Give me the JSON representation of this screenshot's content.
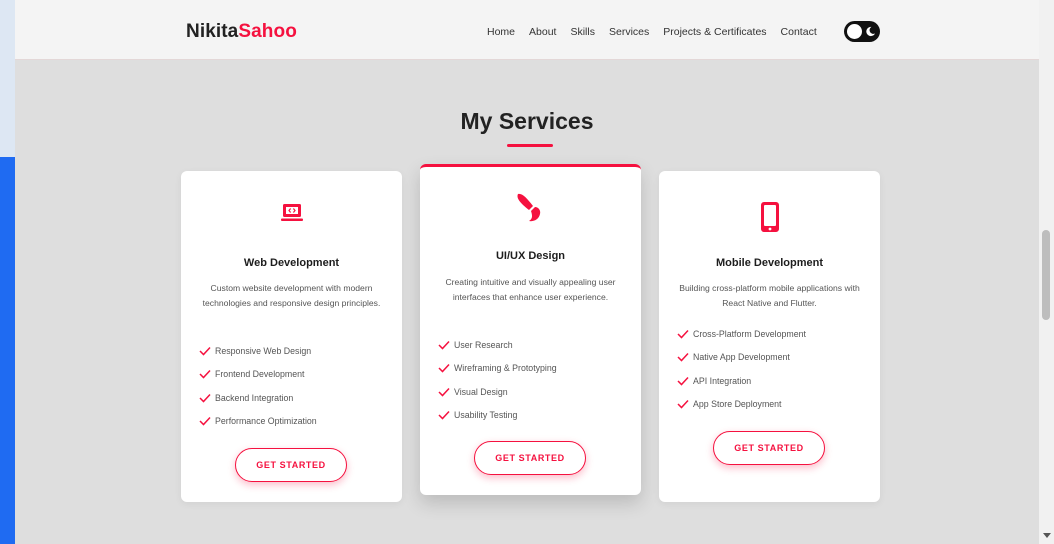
{
  "brand": {
    "first": "Nikita",
    "second": "Sahoo"
  },
  "nav": {
    "items": [
      "Home",
      "About",
      "Skills",
      "Services",
      "Projects & Certificates",
      "Contact"
    ]
  },
  "section": {
    "title": "My Services"
  },
  "cards": [
    {
      "icon": "laptop-code-icon",
      "title": "Web Development",
      "description": "Custom website development with modern technologies and responsive design principles.",
      "features": [
        "Responsive Web Design",
        "Frontend Development",
        "Backend Integration",
        "Performance Optimization"
      ],
      "button": "GET STARTED"
    },
    {
      "icon": "paint-brush-icon",
      "title": "UI/UX Design",
      "description": "Creating intuitive and visually appealing user interfaces that enhance user experience.",
      "features": [
        "User Research",
        "Wireframing & Prototyping",
        "Visual Design",
        "Usability Testing"
      ],
      "button": "GET STARTED"
    },
    {
      "icon": "mobile-icon",
      "title": "Mobile Development",
      "description": "Building cross-platform mobile applications with React Native and Flutter.",
      "features": [
        "Cross-Platform Development",
        "Native App Development",
        "API Integration",
        "App Store Deployment"
      ],
      "button": "GET STARTED"
    }
  ],
  "colors": {
    "accent": "#f5113f",
    "page_bg": "#dedede",
    "nav_bg": "#f4f4f4"
  }
}
